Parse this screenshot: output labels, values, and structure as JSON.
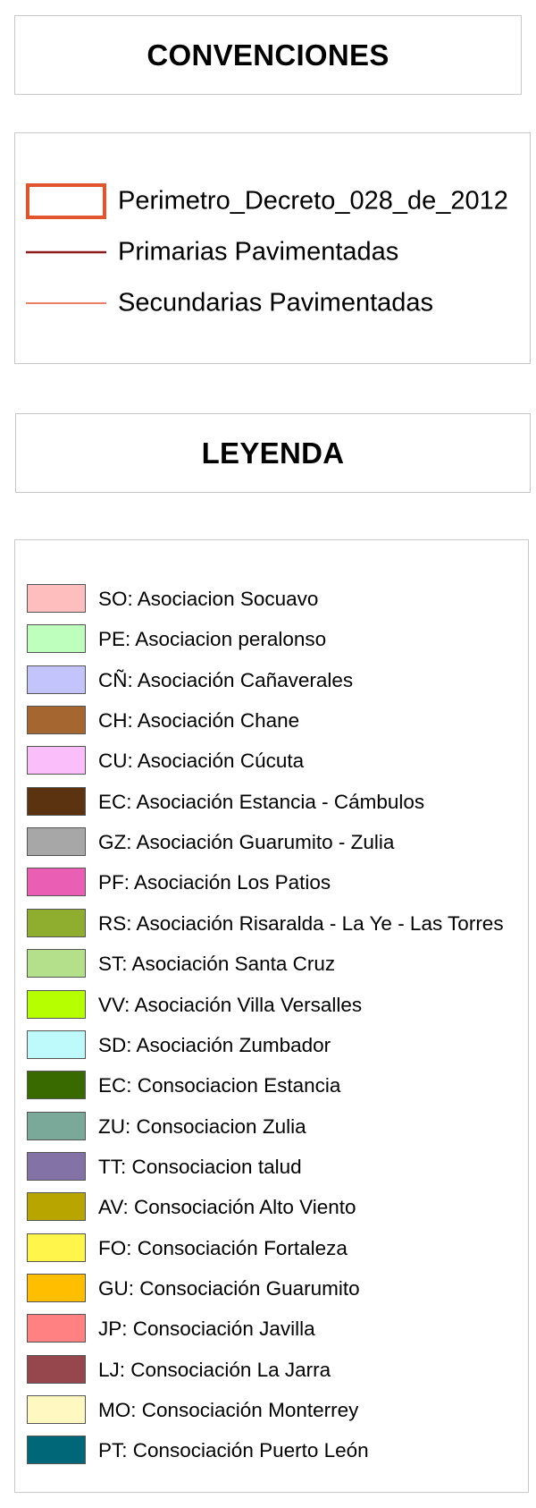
{
  "convenciones": {
    "title": "CONVENCIONES",
    "items": [
      {
        "label": "Perimetro_Decreto_028_de_2012",
        "symbol": "dashed-perimeter-icon",
        "color": "#e2552c"
      },
      {
        "label": "Primarias Pavimentadas",
        "symbol": "primary-road-line-icon",
        "color": "#8b1a1a"
      },
      {
        "label": "Secundarias Pavimentadas",
        "symbol": "secondary-road-line-icon",
        "color": "#e8553a"
      }
    ]
  },
  "leyenda": {
    "title": "LEYENDA",
    "items": [
      {
        "label": "SO: Asociacion Socuavo",
        "color": "#ffbebe"
      },
      {
        "label": "PE: Asociacion peralonso",
        "color": "#beffbe"
      },
      {
        "label": "CÑ: Asociación Cañaverales",
        "color": "#c4c4fc"
      },
      {
        "label": "CH: Asociación Chane",
        "color": "#a5672f"
      },
      {
        "label": "CU: Asociación Cúcuta",
        "color": "#fabefa"
      },
      {
        "label": "EC: Asociación Estancia - Cámbulos",
        "color": "#5c3311"
      },
      {
        "label": "GZ: Asociación Guarumito - Zulia",
        "color": "#a7a7a7"
      },
      {
        "label": "PF: Asociación Los Patios",
        "color": "#ea5eb3"
      },
      {
        "label": "RS: Asociación Risaralda - La Ye - Las Torres",
        "color": "#8fae2f"
      },
      {
        "label": "ST: Asociación Santa Cruz",
        "color": "#b5e08b"
      },
      {
        "label": "VV: Asociación Villa Versalles",
        "color": "#b5ff00"
      },
      {
        "label": "SD: Asociación Zumbador",
        "color": "#bef9fb"
      },
      {
        "label": "EC: Consociacion Estancia",
        "color": "#386a00"
      },
      {
        "label": "ZU: Consociacion Zulia",
        "color": "#7aa999"
      },
      {
        "label": "TT: Consociacion talud",
        "color": "#8272a6"
      },
      {
        "label": "AV: Consociación Alto Viento",
        "color": "#b8a500"
      },
      {
        "label": "FO: Consociación Fortaleza",
        "color": "#fff54b"
      },
      {
        "label": "GU: Consociación Guarumito",
        "color": "#ffbe00"
      },
      {
        "label": "JP: Consociación Javilla",
        "color": "#ff8181"
      },
      {
        "label": "LJ: Consociación La Jarra",
        "color": "#96474d"
      },
      {
        "label": "MO: Consociación Monterrey",
        "color": "#fff8c0"
      },
      {
        "label": "PT: Consociación Puerto León",
        "color": "#006778"
      }
    ]
  }
}
